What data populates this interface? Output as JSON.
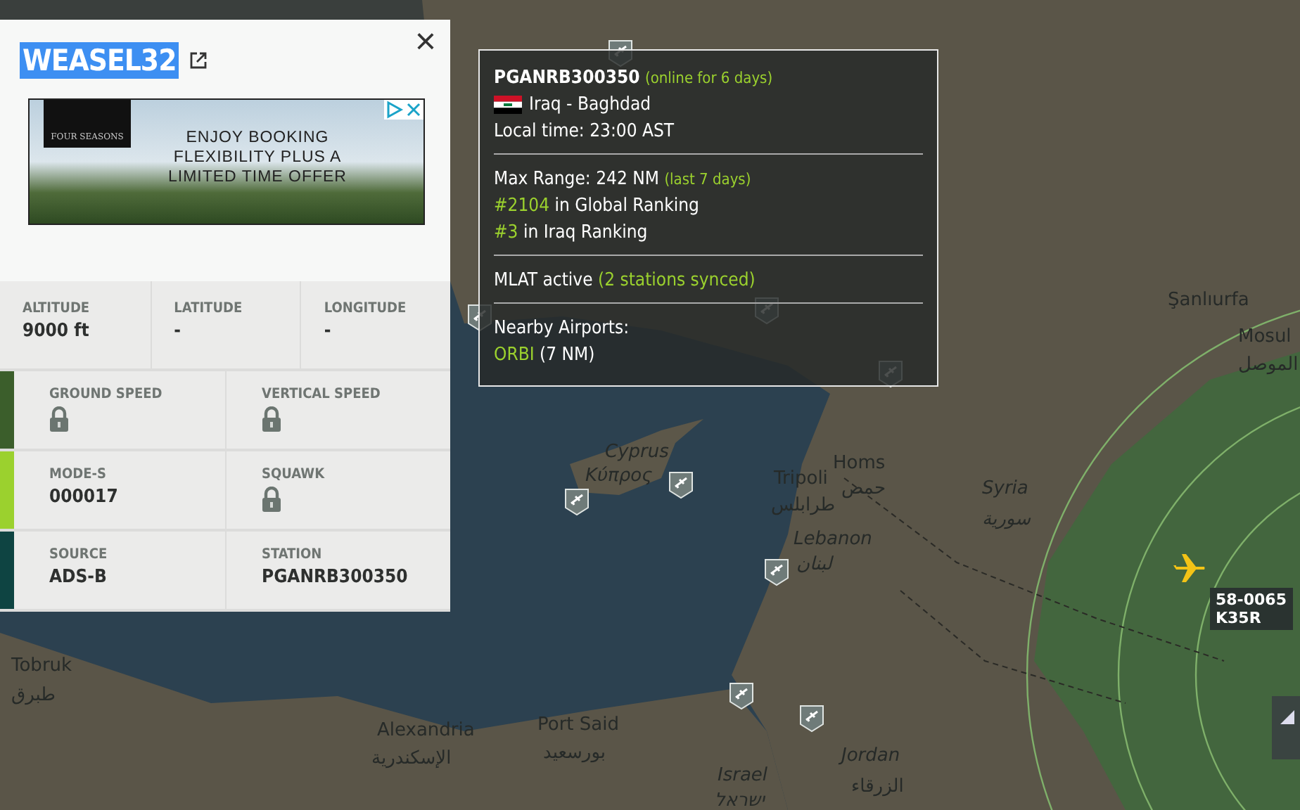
{
  "flight_panel": {
    "callsign": "WEASEL32",
    "highlighted": true,
    "close_glyph": "×",
    "ad": {
      "brand": "FOUR SEASONS",
      "headline": "ENJOY BOOKING FLEXIBILITY PLUS A LIMITED TIME OFFER"
    },
    "top_stats": [
      {
        "label": "ALTITUDE",
        "value": "9000 ft"
      },
      {
        "label": "LATITUDE",
        "value": "-"
      },
      {
        "label": "LONGITUDE",
        "value": "-"
      }
    ],
    "rows": [
      {
        "color": "#3b5e2b",
        "cells": [
          {
            "label": "GROUND SPEED",
            "locked": true
          },
          {
            "label": "VERTICAL SPEED",
            "locked": true
          }
        ]
      },
      {
        "color": "#9bd12e",
        "cells": [
          {
            "label": "MODE-S",
            "locked": false,
            "value": "000017"
          },
          {
            "label": "SQUAWK",
            "locked": true
          }
        ]
      },
      {
        "color": "#0e4442",
        "cells": [
          {
            "label": "SOURCE",
            "locked": false,
            "value": "ADS-B"
          },
          {
            "label": "STATION",
            "locked": false,
            "value": "PGANRB300350"
          }
        ]
      }
    ]
  },
  "station_tooltip": {
    "station": "PGANRB300350",
    "online": "(online for 6 days)",
    "location": "Iraq - Baghdad",
    "local_time": "Local time: 23:00 AST",
    "max_range": "Max Range: 242 NM",
    "range_note": "(last 7 days)",
    "global_rank": "#2104",
    "global_rank_text": "in Global Ranking",
    "country_rank": "#3",
    "country_rank_text": "in Iraq Ranking",
    "mlat": "MLAT active",
    "mlat_note": "(2 stations synced)",
    "airports_heading": "Nearby Airports:",
    "airport_code": "ORBI",
    "airport_distance": "(7 NM)"
  },
  "map": {
    "labels": [
      {
        "text": "Şanlıurfa",
        "kind": "city"
      },
      {
        "text": "Mosul",
        "kind": "city"
      },
      {
        "text": "الموصل",
        "kind": "city"
      },
      {
        "text": "Cyprus",
        "kind": "country"
      },
      {
        "text": "Κύπρος",
        "kind": "country"
      },
      {
        "text": "Homs",
        "kind": "city"
      },
      {
        "text": "حمص",
        "kind": "city"
      },
      {
        "text": "Tripoli",
        "kind": "city"
      },
      {
        "text": "طرابلس",
        "kind": "city"
      },
      {
        "text": "Syria",
        "kind": "country"
      },
      {
        "text": "سورية",
        "kind": "country"
      },
      {
        "text": "Lebanon",
        "kind": "country"
      },
      {
        "text": "لبنان",
        "kind": "country"
      },
      {
        "text": "Tobruk",
        "kind": "city"
      },
      {
        "text": "طبرق",
        "kind": "city"
      },
      {
        "text": "Alexandria",
        "kind": "city"
      },
      {
        "text": "الإسكندرية",
        "kind": "city"
      },
      {
        "text": "Port Said",
        "kind": "city"
      },
      {
        "text": "بورسعيد",
        "kind": "city"
      },
      {
        "text": "Jordan",
        "kind": "country"
      },
      {
        "text": "الزرقاء",
        "kind": "city"
      },
      {
        "text": "Israel",
        "kind": "country"
      },
      {
        "text": "ישראל",
        "kind": "country"
      }
    ],
    "aircraft": {
      "registration": "58-0065",
      "type": "K35R"
    }
  }
}
